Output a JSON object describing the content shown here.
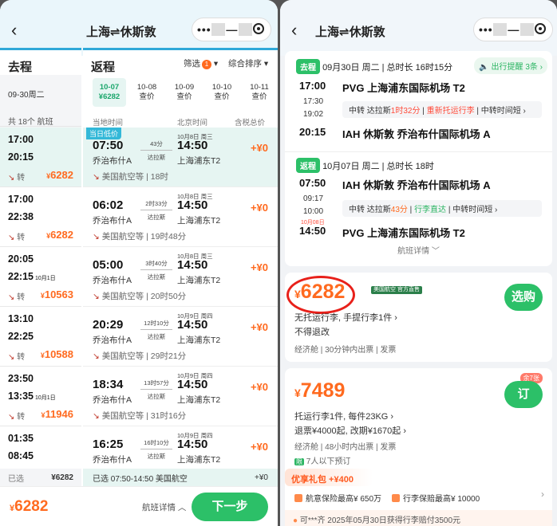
{
  "left": {
    "title": "上海⇌休斯敦",
    "outbound_label": "去程",
    "return_label": "返程",
    "outbound_date": "09-30周二",
    "flight_count": "共 18个 航班",
    "filter_label": "筛选",
    "filter_badge": "1",
    "sort_label": "综合排序",
    "date_tabs": [
      {
        "date": "10-07",
        "price": "¥6282"
      },
      {
        "date": "10-08",
        "price": "查价"
      },
      {
        "date": "10-09",
        "price": "查价"
      },
      {
        "date": "10-10",
        "price": "查价"
      },
      {
        "date": "10-11",
        "price": "查价"
      }
    ],
    "col_local": "当地时间",
    "col_bj": "北京时间",
    "col_tax": "含税总价",
    "outbound_flights": [
      {
        "dep": "17:00",
        "arr": "20:15",
        "next_day": "",
        "transfer": "转",
        "price": "6282"
      },
      {
        "dep": "17:00",
        "arr": "22:38",
        "next_day": "",
        "transfer": "转",
        "price": "6282"
      },
      {
        "dep": "20:05",
        "arr": "22:15",
        "next_day": "10月1日",
        "transfer": "转",
        "price": "10563"
      },
      {
        "dep": "13:10",
        "arr": "22:25",
        "next_day": "",
        "transfer": "转",
        "price": "10588"
      },
      {
        "dep": "23:50",
        "arr": "13:35",
        "next_day": "10月1日",
        "transfer": "转",
        "price": "11946"
      },
      {
        "dep": "01:35",
        "arr": "08:45",
        "next_day": "",
        "transfer": "",
        "price": ""
      }
    ],
    "lowest_tag": "当日低价",
    "return_flights": [
      {
        "dep": "07:50",
        "arr": "14:50",
        "arr_date": "10月8日 周三",
        "dur": "43分",
        "via": "达拉斯",
        "dep_ap": "乔治布什A",
        "arr_ap": "上海浦东T2",
        "airline": "美国航空等",
        "total": "18时",
        "plus": "+¥0"
      },
      {
        "dep": "06:02",
        "arr": "14:50",
        "arr_date": "10月8日 周三",
        "dur": "2时33分",
        "via": "达拉斯",
        "dep_ap": "乔治布什A",
        "arr_ap": "上海浦东T2",
        "airline": "美国航空等",
        "total": "19时48分",
        "plus": "+¥0"
      },
      {
        "dep": "05:00",
        "arr": "14:50",
        "arr_date": "10月8日 周三",
        "dur": "3时40分",
        "via": "达拉斯",
        "dep_ap": "乔治布什A",
        "arr_ap": "上海浦东T2",
        "airline": "美国航空等",
        "total": "20时50分",
        "plus": "+¥0"
      },
      {
        "dep": "20:29",
        "arr": "14:50",
        "arr_date": "10月9日 周四",
        "dur": "12时10分",
        "via": "达拉斯",
        "dep_ap": "乔治布什A",
        "arr_ap": "上海浦东T2",
        "airline": "美国航空等",
        "total": "29时21分",
        "plus": "+¥0"
      },
      {
        "dep": "18:34",
        "arr": "14:50",
        "arr_date": "10月9日 周四",
        "dur": "13时57分",
        "via": "达拉斯",
        "dep_ap": "乔治布什A",
        "arr_ap": "上海浦东T2",
        "airline": "美国航空等",
        "total": "31时16分",
        "plus": "+¥0"
      },
      {
        "dep": "16:25",
        "arr": "14:50",
        "arr_date": "10月9日 周四",
        "dur": "16时10分",
        "via": "达拉斯",
        "dep_ap": "乔治布什A",
        "arr_ap": "上海浦东T2",
        "airline": "",
        "total": "",
        "plus": "+¥0"
      }
    ],
    "selected_label": "已选",
    "selected_price": "¥6282",
    "selected_return": "已选 07:50-14:50 美国航空",
    "selected_return_plus": "+¥0",
    "footer_price": "6282",
    "footer_detail": "航班详情",
    "next_button": "下一步"
  },
  "right": {
    "title": "上海⇌休斯敦",
    "out_tag": "去程",
    "out_info": "09月30日 周二 | 总时长 16时15分",
    "remind": "出行提醒 3条",
    "out_dep_time": "17:00",
    "out_dep_ap": "PVG 上海浦东国际机场 T2",
    "out_mid1": "17:30",
    "out_mid2": "19:02",
    "out_transit_a": "中转 达拉斯",
    "out_transit_b": "1时32分",
    "out_transit_c": "重新托运行李",
    "out_transit_d": "中转时间短",
    "out_arr_time": "20:15",
    "out_arr_ap": "IAH 休斯敦 乔治布什国际机场 A",
    "ret_tag": "返程",
    "ret_info": "10月07日 周二 | 总时长 18时",
    "ret_dep_time": "07:50",
    "ret_dep_ap": "IAH 休斯敦 乔治布什国际机场 A",
    "ret_mid1": "09:17",
    "ret_mid2": "10:00",
    "ret_transit_a": "中转 达拉斯",
    "ret_transit_b": "43分",
    "ret_transit_c": "行李直达",
    "ret_transit_d": "中转时间短",
    "ret_next_day": "10月08日",
    "ret_arr_time": "14:50",
    "ret_arr_ap": "PVG 上海浦东国际机场 T2",
    "detail": "航班详情",
    "offer1": {
      "price": "6282",
      "badge": "美国航空 官方直售",
      "bag": "无托运行李, 手提行李1件",
      "refund": "不得退改",
      "cabin": "经济舱 | 30分钟内出票 | 发票",
      "button": "选购"
    },
    "offer2": {
      "price": "7489",
      "tag": "余7张",
      "bag": "托运行李1件, 每件23KG",
      "refund": "退票¥4000起, 改期¥1670起",
      "cabin": "经济舱 | 48小时内出票 | 发票",
      "seats": "7人以下预订",
      "button": "订"
    },
    "gift": "优享礼包 +¥400",
    "ins1": "航意保险最高¥ 650万",
    "ins2": "行李保赔最高¥ 10000",
    "bottom_bar": "可***齐 2025年05月30日获得行李赔付3500元"
  }
}
